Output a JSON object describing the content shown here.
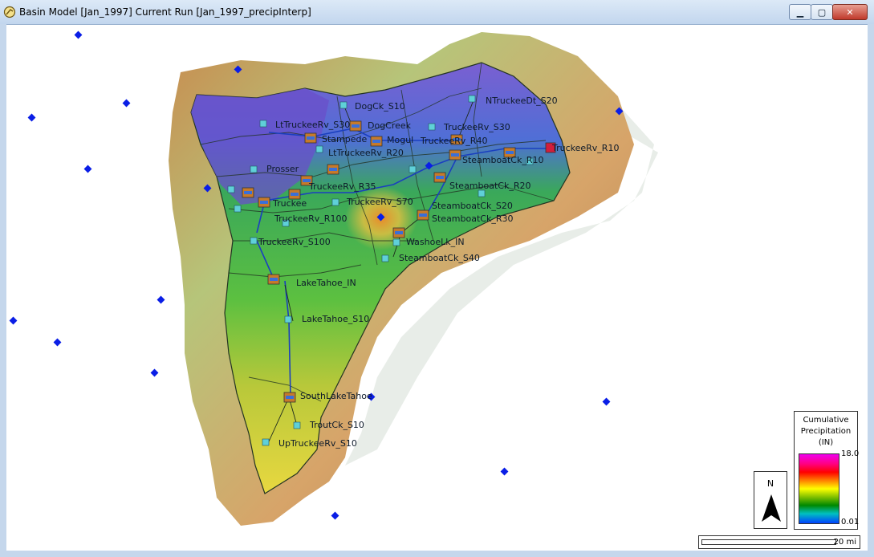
{
  "window": {
    "title": "Basin Model [Jan_1997] Current Run [Jan_1997_precipInterp]",
    "minimize_glyph": "▁",
    "maximize_glyph": "▢",
    "close_glyph": "✕"
  },
  "legend": {
    "title_line1": "Cumulative",
    "title_line2": "Precipitation",
    "title_line3": "(IN)",
    "max_label": "18.0",
    "min_label": "0.01"
  },
  "north_arrow": {
    "label": "N"
  },
  "scale_bar": {
    "label": "20 mi"
  },
  "colors": {
    "gage_marker": "#0a1ee6",
    "reach_line": "#1a3fbf",
    "subbasin_outline": "#223322"
  },
  "map_labels": [
    {
      "id": "dogck-s10",
      "text": "DogCk_S10"
    },
    {
      "id": "ntruckeedt-s20",
      "text": "NTruckeeDt_S20"
    },
    {
      "id": "lttruckeerv-s30",
      "text": "LtTruckeeRv_S30"
    },
    {
      "id": "dogcreek",
      "text": "DogCreek"
    },
    {
      "id": "truckeerv-s30",
      "text": "TruckeeRv_S30"
    },
    {
      "id": "stampede",
      "text": "Stampede"
    },
    {
      "id": "mogul",
      "text": "Mogul"
    },
    {
      "id": "truckeerv-r40",
      "text": "TruckeeRv_R40"
    },
    {
      "id": "truckeerv-r10",
      "text": "TruckeeRv_R10"
    },
    {
      "id": "lttruckeerv-r20",
      "text": "LtTruckeeRv_R20"
    },
    {
      "id": "steamboatck-r10",
      "text": "SteamboatCk_R10"
    },
    {
      "id": "prosser",
      "text": "Prosser"
    },
    {
      "id": "truckeerv-r35",
      "text": "TruckeeRv_R35"
    },
    {
      "id": "steamboatck-r20",
      "text": "SteamboatCk_R20"
    },
    {
      "id": "truckee",
      "text": "Truckee"
    },
    {
      "id": "truckeerv-s70",
      "text": "TruckeeRv_S70"
    },
    {
      "id": "steamboatck-s20",
      "text": "SteamboatCk_S20"
    },
    {
      "id": "truckeerv-r100",
      "text": "TruckeeRv_R100"
    },
    {
      "id": "steamboatck-r30",
      "text": "SteamboatCk_R30"
    },
    {
      "id": "truckeerv-s100",
      "text": "TruckeeRv_S100"
    },
    {
      "id": "washoelk-in",
      "text": "WashoeLk_IN"
    },
    {
      "id": "steamboatck-s40",
      "text": "SteamboatCk_S40"
    },
    {
      "id": "laketahoe-in",
      "text": "LakeTahoe_IN"
    },
    {
      "id": "laketahoe-s10",
      "text": "LakeTahoe_S10"
    },
    {
      "id": "southlaketahoe",
      "text": "SouthLakeTahoe"
    },
    {
      "id": "troutck-s10",
      "text": "TroutCk_S10"
    },
    {
      "id": "uptruckeerv-s10",
      "text": "UpTruckeeRv_S10"
    }
  ]
}
